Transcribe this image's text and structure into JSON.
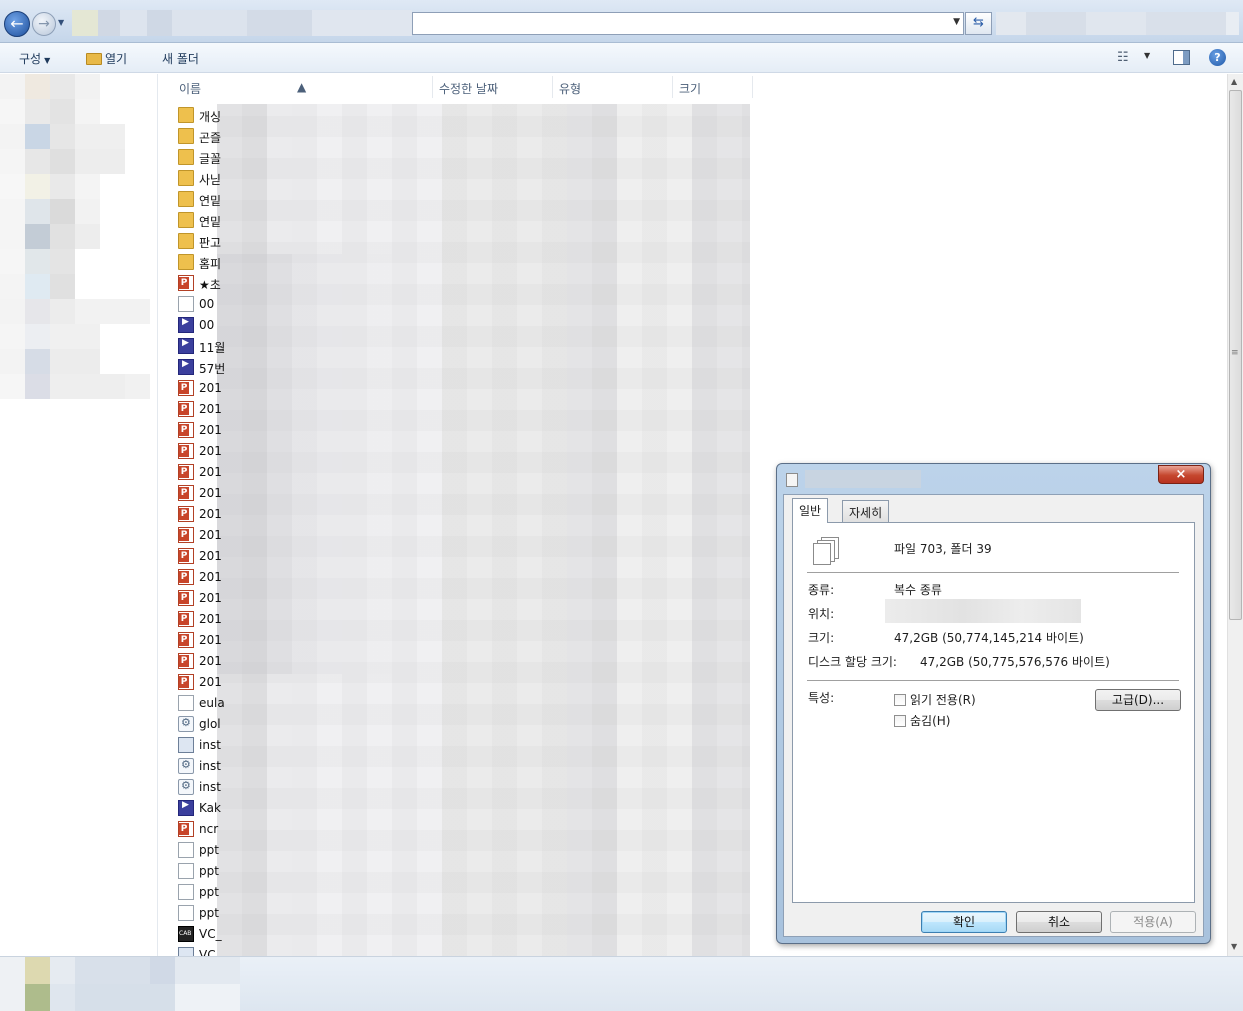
{
  "toolbar": {
    "organize_label": "구성",
    "open_label": "열기",
    "new_folder_label": "새 폴더"
  },
  "columns": {
    "name": "이름",
    "modified": "수정한 날짜",
    "type": "유형",
    "size": "크기"
  },
  "files": [
    {
      "name": "개싱",
      "icon": "folder"
    },
    {
      "name": "곤즐",
      "icon": "folder"
    },
    {
      "name": "글꼴",
      "icon": "folder"
    },
    {
      "name": "사닏",
      "icon": "folder"
    },
    {
      "name": "연밑",
      "icon": "folder"
    },
    {
      "name": "연밑",
      "icon": "folder"
    },
    {
      "name": "판고",
      "icon": "folder"
    },
    {
      "name": "홈피",
      "icon": "folder"
    },
    {
      "name": "★초",
      "icon": "ppt"
    },
    {
      "name": "00",
      "icon": "file"
    },
    {
      "name": "00",
      "icon": "video"
    },
    {
      "name": "11월",
      "icon": "video"
    },
    {
      "name": "57번",
      "icon": "video"
    },
    {
      "name": "201",
      "icon": "ppt"
    },
    {
      "name": "201",
      "icon": "ppt"
    },
    {
      "name": "201",
      "icon": "ppt"
    },
    {
      "name": "201",
      "icon": "ppt"
    },
    {
      "name": "201",
      "icon": "ppt"
    },
    {
      "name": "201",
      "icon": "ppt"
    },
    {
      "name": "201",
      "icon": "ppt"
    },
    {
      "name": "201",
      "icon": "ppt"
    },
    {
      "name": "201",
      "icon": "ppt"
    },
    {
      "name": "201",
      "icon": "ppt"
    },
    {
      "name": "201",
      "icon": "ppt"
    },
    {
      "name": "201",
      "icon": "ppt"
    },
    {
      "name": "201",
      "icon": "ppt"
    },
    {
      "name": "201",
      "icon": "ppt"
    },
    {
      "name": "201",
      "icon": "ppt"
    },
    {
      "name": "eula",
      "icon": "file"
    },
    {
      "name": "glol",
      "icon": "gear"
    },
    {
      "name": "inst",
      "icon": "setup"
    },
    {
      "name": "inst",
      "icon": "gear"
    },
    {
      "name": "inst",
      "icon": "gear"
    },
    {
      "name": "Kak",
      "icon": "video"
    },
    {
      "name": "ncr",
      "icon": "ppt"
    },
    {
      "name": "ppt",
      "icon": "file"
    },
    {
      "name": "ppt",
      "icon": "file"
    },
    {
      "name": "ppt",
      "icon": "file"
    },
    {
      "name": "ppt",
      "icon": "file"
    },
    {
      "name": "VC_",
      "icon": "cab"
    },
    {
      "name": "VC_",
      "icon": "setup"
    }
  ],
  "dialog": {
    "close_glyph": "×",
    "tab_general": "일반",
    "tab_details": "자세히",
    "summary": "파일 703, 폴더 39",
    "type_label": "종류:",
    "type_value": "복수 종류",
    "location_label": "위치:",
    "size_label": "크기:",
    "size_value": "47,2GB (50,774,145,214 바이트)",
    "disk_size_label": "디스크 할당 크기:",
    "disk_size_value": "47,2GB (50,775,576,576 바이트)",
    "attributes_label": "특성:",
    "readonly_label": "읽기 전용(R)",
    "hidden_label": "숨김(H)",
    "advanced_button": "고급(D)...",
    "ok_button": "확인",
    "cancel_button": "취소",
    "apply_button": "적용(A)"
  },
  "icons": {
    "back": "arrow-left-icon",
    "forward": "arrow-right-icon",
    "refresh": "refresh-icon",
    "open": "folder-open-icon",
    "views": "view-options-icon",
    "preview_pane": "preview-pane-icon",
    "help": "help-icon"
  }
}
